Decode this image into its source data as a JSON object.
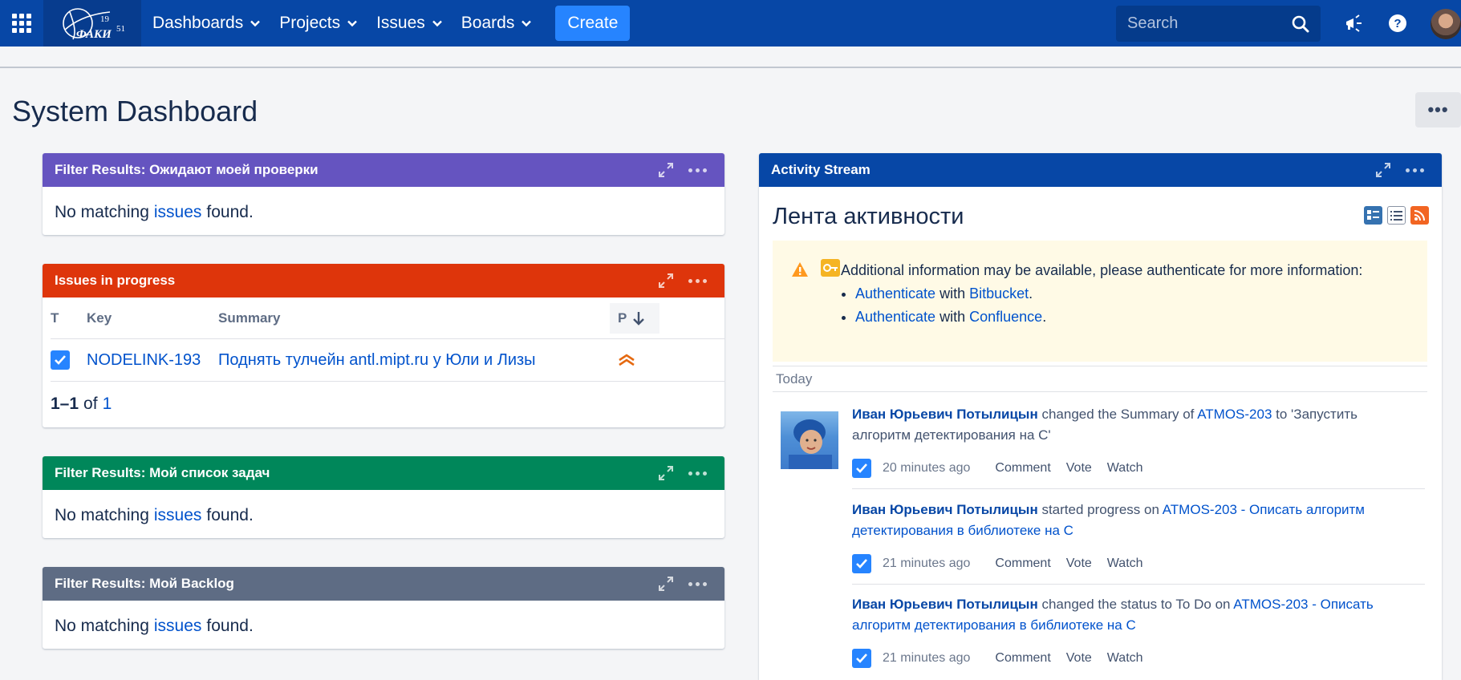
{
  "topbar": {
    "nav": [
      "Dashboards",
      "Projects",
      "Issues",
      "Boards"
    ],
    "create_label": "Create",
    "search_placeholder": "Search",
    "colors": {
      "bar": "#0747a6",
      "create": "#2684ff"
    }
  },
  "page": {
    "title": "System Dashboard",
    "more_label": "•••"
  },
  "gadgets": {
    "awaiting_review": {
      "title": "Filter Results: Ожидают моей проверки",
      "msg_pre": "No matching",
      "msg_link": "issues",
      "msg_post": "found.",
      "color": "#6554c0"
    },
    "in_progress": {
      "title": "Issues in progress",
      "color": "#de350b",
      "columns": {
        "t": "T",
        "key": "Key",
        "summary": "Summary",
        "p": "P"
      },
      "rows": [
        {
          "key": "NODELINK-193",
          "summary": "Поднять тулчейн antl.mipt.ru у Юли и Лизы",
          "priority_icon": "highest-priority-icon"
        }
      ],
      "pager": {
        "range": "1–1",
        "of": "of",
        "total": "1"
      }
    },
    "my_tasks": {
      "title": "Filter Results: Мой список задач",
      "msg_pre": "No matching",
      "msg_link": "issues",
      "msg_post": "found.",
      "color": "#00875a"
    },
    "my_backlog": {
      "title": "Filter Results: Мой Backlog",
      "msg_pre": "No matching",
      "msg_link": "issues",
      "msg_post": "found.",
      "color": "#5e6c84"
    },
    "activity": {
      "title": "Activity Stream",
      "color": "#0747a6",
      "heading": "Лента активности",
      "notice": {
        "text": "Additional information may be available, please authenticate for more information:",
        "items": [
          {
            "link": "Authenticate",
            "with": "with",
            "target": "Bitbucket",
            "end": "."
          },
          {
            "link": "Authenticate",
            "with": "with",
            "target": "Confluence",
            "end": "."
          }
        ]
      },
      "today_label": "Today",
      "entries": [
        {
          "user": "Иван Юрьевич Потылицын",
          "action": "changed the Summary of",
          "issue": "ATMOS-203",
          "rest_line1": "to 'Запустить",
          "rest_line2": "алгоритм детектирования на С'",
          "time": "20 minutes ago",
          "actions": [
            "Comment",
            "Vote",
            "Watch"
          ]
        },
        {
          "user": "Иван Юрьевич Потылицын",
          "action": "started progress on",
          "issue_line1": "ATMOS-203 - Описать алгоритм",
          "issue_line2": "детектирования в библиотеке на С",
          "time": "21 minutes ago",
          "actions": [
            "Comment",
            "Vote",
            "Watch"
          ]
        },
        {
          "user": "Иван Юрьевич Потылицын",
          "action": "changed the status to To Do on",
          "issue_line1": "ATMOS-203 - Описать",
          "issue_line2": "алгоритм детектирования в библиотеке на С",
          "time": "21 minutes ago",
          "actions": [
            "Comment",
            "Vote",
            "Watch"
          ]
        }
      ]
    }
  }
}
